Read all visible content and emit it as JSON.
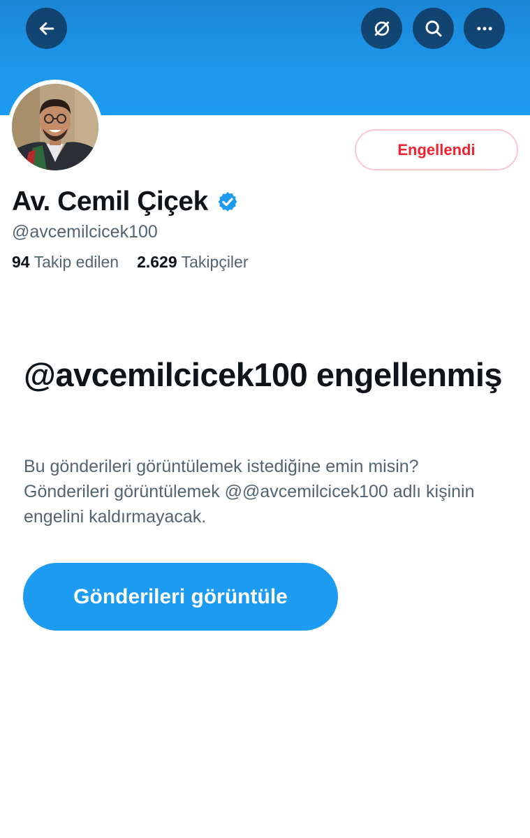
{
  "header": {
    "icons": [
      "back-arrow-icon",
      "translate-icon",
      "search-icon",
      "more-icon"
    ],
    "banner_color": "#1d9bf0"
  },
  "profile": {
    "display_name": "Av. Cemil Çiçek",
    "handle": "@avcemilcicek100",
    "verified": true,
    "following_count": "94",
    "following_label": "Takip edilen",
    "followers_count": "2.629",
    "followers_label": "Takipçiler",
    "blocked_button_label": "Engellendi"
  },
  "blocked_notice": {
    "title": "@avcemilcicek100 engellenmiş",
    "description": "Bu gönderileri görüntülemek istediğine emin misin? Gönderileri görüntülemek @@avcemilcicek100 adlı kişinin engelini kaldırmayacak.",
    "button_label": "Gönderileri görüntüle"
  },
  "colors": {
    "accent": "#1d9bf0",
    "blocked_text": "#f4212e",
    "secondary_text": "#536471",
    "primary_text": "#0f1419"
  }
}
